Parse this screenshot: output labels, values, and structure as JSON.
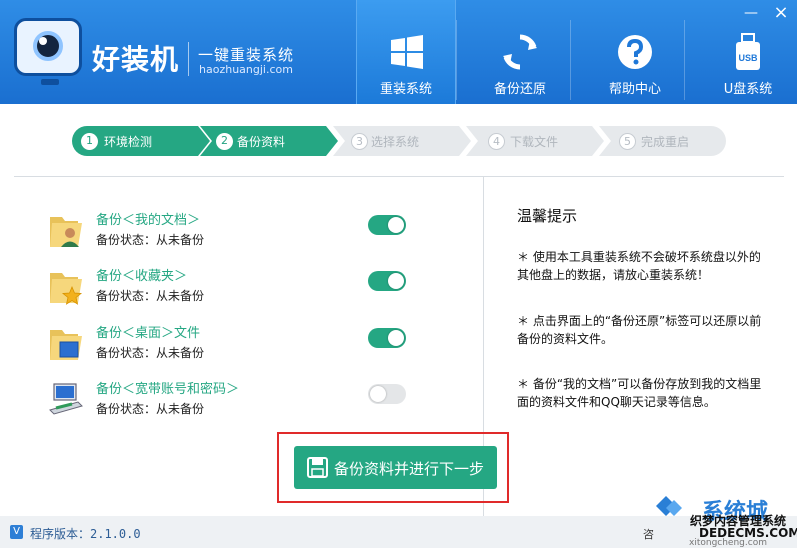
{
  "brand": {
    "name": "好装机",
    "slogan": "一键重装系统",
    "url": "haozhuangji.com"
  },
  "window_controls": {
    "minimize": "—",
    "close": "×"
  },
  "nav": [
    {
      "label": "重装系统",
      "icon": "windows-icon",
      "active": true
    },
    {
      "label": "备份还原",
      "icon": "refresh-icon",
      "active": false
    },
    {
      "label": "帮助中心",
      "icon": "help-icon",
      "active": false
    },
    {
      "label": "U盘系统",
      "icon": "usb-icon",
      "active": false
    }
  ],
  "steps": [
    {
      "num": "1",
      "label": "环境检测",
      "state": "done"
    },
    {
      "num": "2",
      "label": "备份资料",
      "state": "done"
    },
    {
      "num": "3",
      "label": "选择系统",
      "state": "todo"
    },
    {
      "num": "4",
      "label": "下载文件",
      "state": "todo"
    },
    {
      "num": "5",
      "label": "完成重启",
      "state": "todo"
    }
  ],
  "backup_items": [
    {
      "title": "备份＜我的文档＞",
      "status": "备份状态：从未备份",
      "enabled": true,
      "icon": "user-folder-icon"
    },
    {
      "title": "备份＜收藏夹＞",
      "status": "备份状态：从未备份",
      "enabled": true,
      "icon": "favorites-folder-icon"
    },
    {
      "title": "备份＜桌面＞文件",
      "status": "备份状态：从未备份",
      "enabled": true,
      "icon": "desktop-folder-icon"
    },
    {
      "title": "备份＜宽带账号和密码＞",
      "status": "备份状态：从未备份",
      "enabled": false,
      "icon": "network-icon"
    }
  ],
  "tips": {
    "title": "温馨提示",
    "items": [
      "＊ 使用本工具重装系统不会破坏系统盘以外的其他盘上的数据，请放心重装系统！",
      "＊ 点击界面上的“备份还原”标签可以还原以前备份的资料文件。",
      "＊ 备份“我的文档”可以备份存放到我的文档里面的资料文件和QQ聊天记录等信息。"
    ]
  },
  "main_button": {
    "label": "备份资料并进行下一步"
  },
  "footer": {
    "version_badge": "V",
    "version_text": "程序版本：2.1.0.0"
  },
  "watermark": {
    "big": "系统城",
    "line1": "织梦内容管理系统",
    "line2": "DEDECMS.COM",
    "line3": "xitongcheng.com",
    "cut": "咨"
  },
  "colors": {
    "header": "#1f78d8",
    "accent": "#25a783",
    "highlight": "#e02a2a"
  }
}
